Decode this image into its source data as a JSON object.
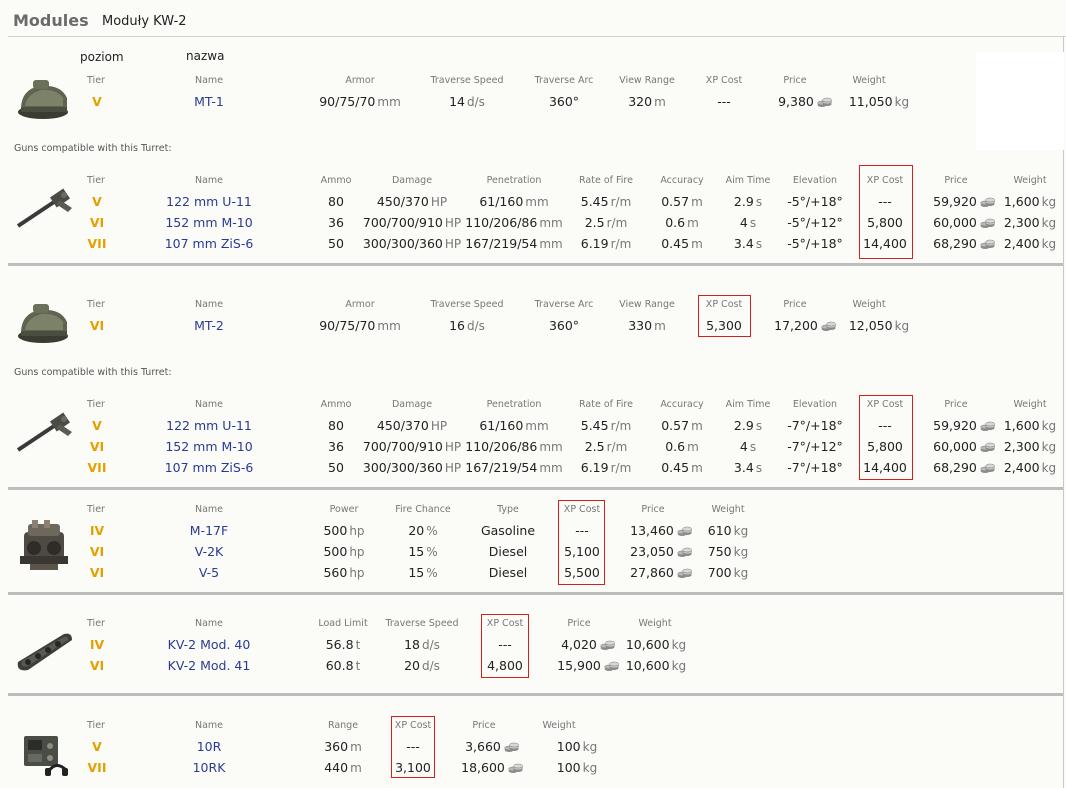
{
  "header": {
    "title": "Modules",
    "subtitle": "Moduły KW-2"
  },
  "annotations": {
    "tier_pl": "poziom",
    "name_pl": "nazwa"
  },
  "units": {
    "mm": "mm",
    "ds": "d/s",
    "deg": "360°",
    "m": "m",
    "kg": "kg",
    "hp": "hp",
    "HP": "HP",
    "rm": "r/m",
    "s": "s",
    "t": "t",
    "pct": "%"
  },
  "turret_headers": [
    "Tier",
    "Name",
    "Armor",
    "Traverse Speed",
    "Traverse Arc",
    "View Range",
    "XP Cost",
    "Price",
    "Weight"
  ],
  "gun_headers": [
    "Tier",
    "Name",
    "Ammo",
    "Damage",
    "Penetration",
    "Rate of Fire",
    "Accuracy",
    "Aim Time",
    "Elevation",
    "XP Cost",
    "Price",
    "Weight"
  ],
  "guns_caption": "Guns compatible with this Turret:",
  "turret1": {
    "tier": "V",
    "name": "MT-1",
    "armor": "90/75/70",
    "traverse": "14",
    "arc": "360°",
    "view": "320",
    "xp": "---",
    "price": "9,380",
    "weight": "11,050"
  },
  "guns1": [
    {
      "tier": "V",
      "name": "122 mm U-11",
      "ammo": "80",
      "damage": "450/370",
      "pen": "61/160",
      "rof": "5.45",
      "acc": "0.57",
      "aim": "2.9",
      "elev": "-5°/+18°",
      "xp": "---",
      "price": "59,920",
      "weight": "1,600"
    },
    {
      "tier": "VI",
      "name": "152 mm M-10",
      "ammo": "36",
      "damage": "700/700/910",
      "pen": "110/206/86",
      "rof": "2.5",
      "acc": "0.6",
      "aim": "4",
      "elev": "-5°/+12°",
      "xp": "5,800",
      "price": "60,000",
      "weight": "2,300"
    },
    {
      "tier": "VII",
      "name": "107 mm ZiS-6",
      "ammo": "50",
      "damage": "300/300/360",
      "pen": "167/219/54",
      "rof": "6.19",
      "acc": "0.45",
      "aim": "3.4",
      "elev": "-5°/+18°",
      "xp": "14,400",
      "price": "68,290",
      "weight": "2,400"
    }
  ],
  "turret2": {
    "tier": "VI",
    "name": "MT-2",
    "armor": "90/75/70",
    "traverse": "16",
    "arc": "360°",
    "view": "330",
    "xp": "5,300",
    "price": "17,200",
    "weight": "12,050"
  },
  "guns2": [
    {
      "tier": "V",
      "name": "122 mm U-11",
      "ammo": "80",
      "damage": "450/370",
      "pen": "61/160",
      "rof": "5.45",
      "acc": "0.57",
      "aim": "2.9",
      "elev": "-7°/+18°",
      "xp": "---",
      "price": "59,920",
      "weight": "1,600"
    },
    {
      "tier": "VI",
      "name": "152 mm M-10",
      "ammo": "36",
      "damage": "700/700/910",
      "pen": "110/206/86",
      "rof": "2.5",
      "acc": "0.6",
      "aim": "4",
      "elev": "-7°/+12°",
      "xp": "5,800",
      "price": "60,000",
      "weight": "2,300"
    },
    {
      "tier": "VII",
      "name": "107 mm ZiS-6",
      "ammo": "50",
      "damage": "300/300/360",
      "pen": "167/219/54",
      "rof": "6.19",
      "acc": "0.45",
      "aim": "3.4",
      "elev": "-7°/+18°",
      "xp": "14,400",
      "price": "68,290",
      "weight": "2,400"
    }
  ],
  "engine_headers": [
    "Tier",
    "Name",
    "Power",
    "Fire Chance",
    "Type",
    "XP Cost",
    "Price",
    "Weight"
  ],
  "engines": [
    {
      "tier": "IV",
      "name": "M-17F",
      "power": "500",
      "fire": "20",
      "type": "Gasoline",
      "xp": "---",
      "price": "13,460",
      "weight": "610"
    },
    {
      "tier": "VI",
      "name": "V-2K",
      "power": "500",
      "fire": "15",
      "type": "Diesel",
      "xp": "5,100",
      "price": "23,050",
      "weight": "750"
    },
    {
      "tier": "VI",
      "name": "V-5",
      "power": "560",
      "fire": "15",
      "type": "Diesel",
      "xp": "5,500",
      "price": "27,860",
      "weight": "700"
    }
  ],
  "susp_headers": [
    "Tier",
    "Name",
    "Load Limit",
    "Traverse Speed",
    "XP Cost",
    "Price",
    "Weight"
  ],
  "suspensions": [
    {
      "tier": "IV",
      "name": "KV-2 Mod. 40",
      "load": "56.8",
      "traverse": "18",
      "xp": "---",
      "price": "4,020",
      "weight": "10,600"
    },
    {
      "tier": "VI",
      "name": "KV-2 Mod. 41",
      "load": "60.8",
      "traverse": "20",
      "xp": "4,800",
      "price": "15,900",
      "weight": "10,600"
    }
  ],
  "radio_headers": [
    "Tier",
    "Name",
    "Range",
    "XP Cost",
    "Price",
    "Weight"
  ],
  "radios": [
    {
      "tier": "V",
      "name": "10R",
      "range": "360",
      "xp": "---",
      "price": "3,660",
      "weight": "100"
    },
    {
      "tier": "VII",
      "name": "10RK",
      "range": "440",
      "xp": "3,100",
      "price": "18,600",
      "weight": "100"
    }
  ],
  "colors": {
    "tier": "#e3a100",
    "name": "#2a3b95",
    "highlight": "#d12020"
  },
  "icons": {
    "turret": "turret-icon",
    "gun": "gun-icon",
    "engine": "engine-icon",
    "suspension": "tracks-icon",
    "radio": "radio-icon",
    "credits": "credits-coin-icon"
  }
}
